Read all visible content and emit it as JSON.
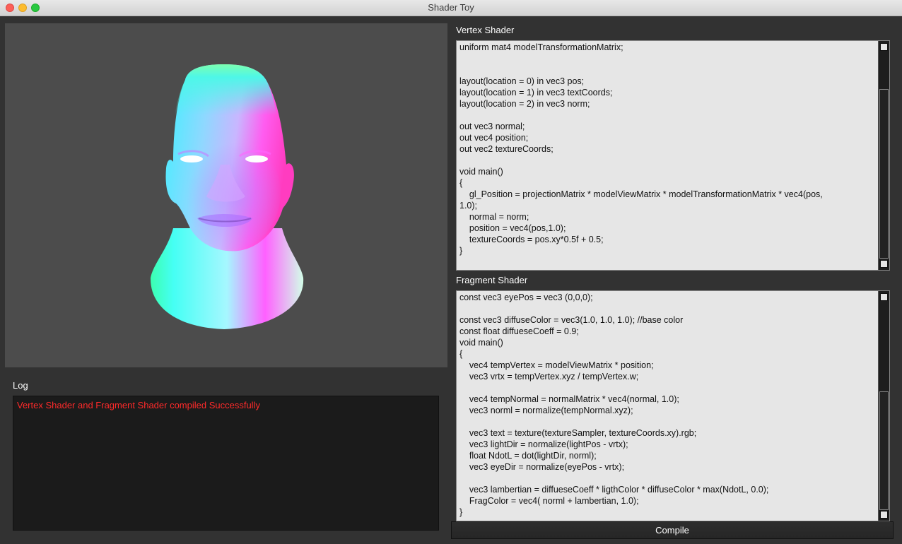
{
  "window": {
    "title": "Shader Toy"
  },
  "log": {
    "label": "Log",
    "message": "Vertex Shader and Fragment Shader compiled Successfully"
  },
  "vertex_shader": {
    "label": "Vertex Shader",
    "code": "uniform mat4 modelTransformationMatrix;\n\n\nlayout(location = 0) in vec3 pos;\nlayout(location = 1) in vec3 textCoords;\nlayout(location = 2) in vec3 norm;\n\nout vec3 normal;\nout vec4 position;\nout vec2 textureCoords;\n\nvoid main()\n{\n    gl_Position = projectionMatrix * modelViewMatrix * modelTransformationMatrix * vec4(pos,\n1.0);\n    normal = norm;\n    position = vec4(pos,1.0);\n    textureCoords = pos.xy*0.5f + 0.5;\n}"
  },
  "fragment_shader": {
    "label": "Fragment Shader",
    "code": "const vec3 eyePos = vec3 (0,0,0);\n\nconst vec3 diffuseColor = vec3(1.0, 1.0, 1.0); //base color\nconst float diffueseCoeff = 0.9;\nvoid main()\n{\n    vec4 tempVertex = modelViewMatrix * position;\n    vec3 vrtx = tempVertex.xyz / tempVertex.w;\n\n    vec4 tempNormal = normalMatrix * vec4(normal, 1.0);\n    vec3 norml = normalize(tempNormal.xyz);\n\n    vec3 text = texture(textureSampler, textureCoords.xy).rgb;\n    vec3 lightDir = normalize(lightPos - vrtx);\n    float NdotL = dot(lightDir, norml);\n    vec3 eyeDir = normalize(eyePos - vrtx);\n\n    vec3 lambertian = diffueseCoeff * ligthColor * diffuseColor * max(NdotL, 0.0);\n    FragColor = vec4( norml + lambertian, 1.0);\n}"
  },
  "compile_button": {
    "label": "Compile"
  },
  "icons": {
    "viewport": "rendered-head-model",
    "scroll_up": "scroll-up-button",
    "scroll_down": "scroll-down-button"
  },
  "colors": {
    "log_text": "#ff2a2a",
    "background": "#323232",
    "viewport_background": "#4c4c4c"
  }
}
